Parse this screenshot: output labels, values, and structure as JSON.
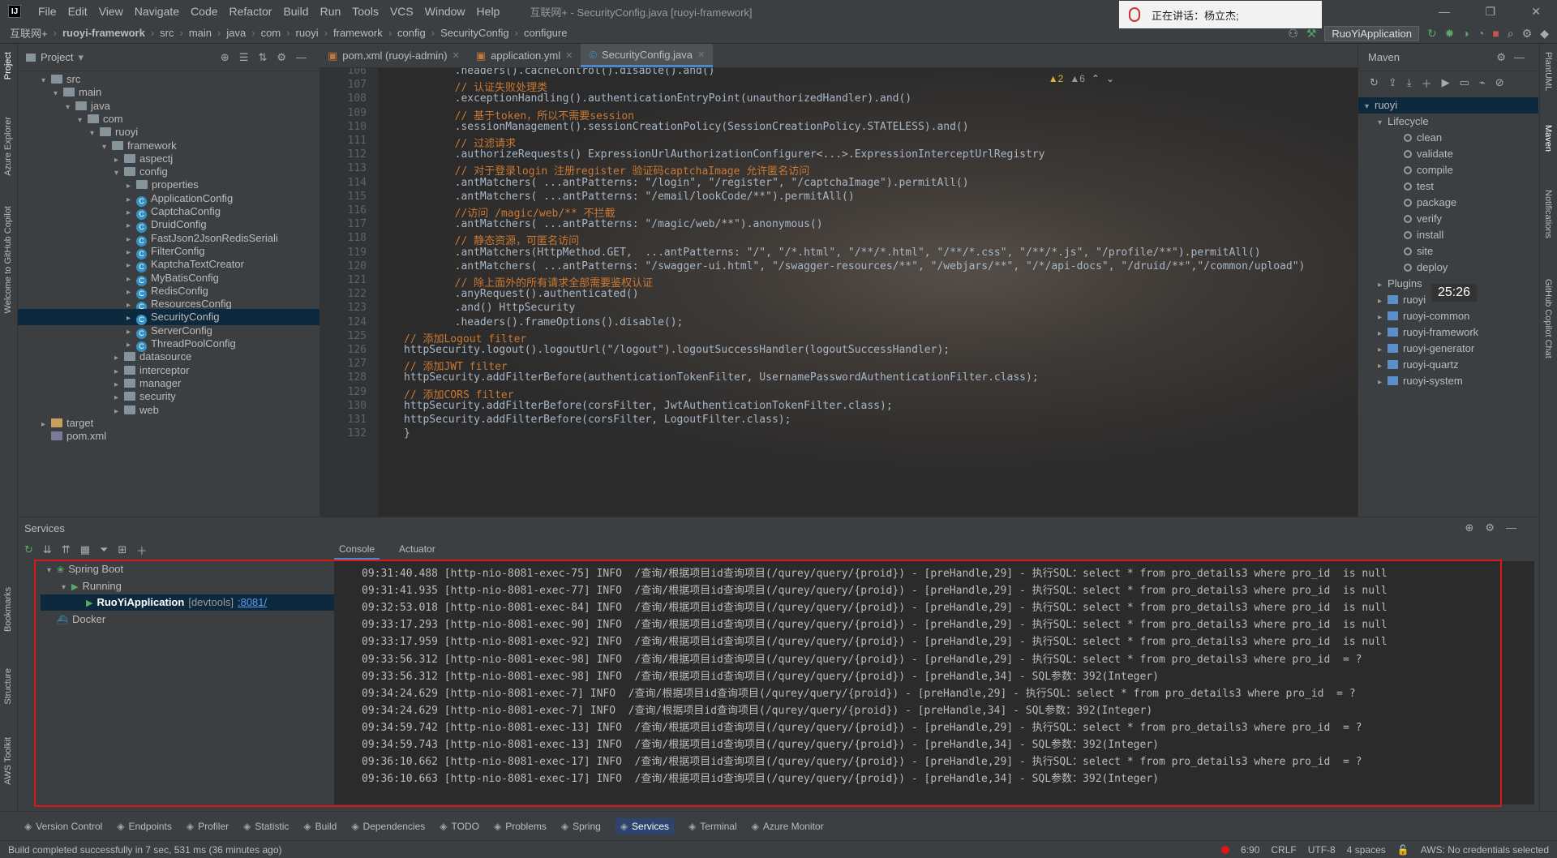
{
  "window": {
    "logo": "IJ",
    "menu": [
      "File",
      "Edit",
      "View",
      "Navigate",
      "Code",
      "Refactor",
      "Build",
      "Run",
      "Tools",
      "VCS",
      "Window",
      "Help"
    ],
    "title": "互联网+ - SecurityConfig.java [ruoyi-framework]",
    "speaking_label": "正在讲话：杨立杰;"
  },
  "breadcrumb": [
    "互联网+",
    "ruoyi-framework",
    "src",
    "main",
    "java",
    "com",
    "ruoyi",
    "framework",
    "config",
    "SecurityConfig",
    "configure"
  ],
  "run_config": "RuoYiApplication",
  "project": {
    "header": "Project",
    "tree": [
      {
        "label": "src",
        "depth": 1,
        "kind": "folder",
        "arrow": "▾"
      },
      {
        "label": "main",
        "depth": 2,
        "kind": "folder",
        "arrow": "▾"
      },
      {
        "label": "java",
        "depth": 3,
        "kind": "folder",
        "arrow": "▾"
      },
      {
        "label": "com",
        "depth": 4,
        "kind": "folder",
        "arrow": "▾"
      },
      {
        "label": "ruoyi",
        "depth": 5,
        "kind": "folder",
        "arrow": "▾"
      },
      {
        "label": "framework",
        "depth": 6,
        "kind": "folder",
        "arrow": "▾"
      },
      {
        "label": "aspectj",
        "depth": 7,
        "kind": "folder",
        "arrow": "▸"
      },
      {
        "label": "config",
        "depth": 7,
        "kind": "folder",
        "arrow": "▾"
      },
      {
        "label": "properties",
        "depth": 8,
        "kind": "folder",
        "arrow": "▸"
      },
      {
        "label": "ApplicationConfig",
        "depth": 8,
        "kind": "class",
        "arrow": "▸"
      },
      {
        "label": "CaptchaConfig",
        "depth": 8,
        "kind": "class",
        "arrow": "▸"
      },
      {
        "label": "DruidConfig",
        "depth": 8,
        "kind": "class",
        "arrow": "▸"
      },
      {
        "label": "FastJson2JsonRedisSeriali",
        "depth": 8,
        "kind": "class",
        "arrow": "▸"
      },
      {
        "label": "FilterConfig",
        "depth": 8,
        "kind": "class",
        "arrow": "▸"
      },
      {
        "label": "KaptchaTextCreator",
        "depth": 8,
        "kind": "class",
        "arrow": "▸"
      },
      {
        "label": "MyBatisConfig",
        "depth": 8,
        "kind": "class",
        "arrow": "▸"
      },
      {
        "label": "RedisConfig",
        "depth": 8,
        "kind": "class",
        "arrow": "▸"
      },
      {
        "label": "ResourcesConfig",
        "depth": 8,
        "kind": "class",
        "arrow": "▸"
      },
      {
        "label": "SecurityConfig",
        "depth": 8,
        "kind": "class",
        "arrow": "▸",
        "selected": true
      },
      {
        "label": "ServerConfig",
        "depth": 8,
        "kind": "class",
        "arrow": "▸"
      },
      {
        "label": "ThreadPoolConfig",
        "depth": 8,
        "kind": "class",
        "arrow": "▸"
      },
      {
        "label": "datasource",
        "depth": 7,
        "kind": "folder",
        "arrow": "▸"
      },
      {
        "label": "interceptor",
        "depth": 7,
        "kind": "folder",
        "arrow": "▸"
      },
      {
        "label": "manager",
        "depth": 7,
        "kind": "folder",
        "arrow": "▸"
      },
      {
        "label": "security",
        "depth": 7,
        "kind": "folder",
        "arrow": "▸"
      },
      {
        "label": "web",
        "depth": 7,
        "kind": "folder",
        "arrow": "▸"
      },
      {
        "label": "target",
        "depth": 1,
        "kind": "folder-orange",
        "arrow": "▸"
      },
      {
        "label": "pom.xml",
        "depth": 1,
        "kind": "file",
        "arrow": ""
      }
    ]
  },
  "editor": {
    "tabs": [
      {
        "label": "pom.xml (ruoyi-admin)",
        "active": false
      },
      {
        "label": "application.yml",
        "active": false
      },
      {
        "label": "SecurityConfig.java",
        "active": true
      }
    ],
    "inspections": {
      "warnings": "▲2",
      "weak": "▲6"
    },
    "lines": [
      {
        "n": "106",
        "t": "        .headers().cacheControl().disable().and()",
        "c": "code"
      },
      {
        "n": "107",
        "t": "        // 认证失败处理类",
        "c": "cmt"
      },
      {
        "n": "108",
        "t": "        .exceptionHandling().authenticationEntryPoint(unauthorizedHandler).and()",
        "c": "code"
      },
      {
        "n": "109",
        "t": "        // 基于token，所以不需要session",
        "c": "cmt"
      },
      {
        "n": "110",
        "t": "        .sessionManagement().sessionCreationPolicy(SessionCreationPolicy.STATELESS).and()",
        "c": "code"
      },
      {
        "n": "111",
        "t": "        // 过滤请求",
        "c": "cmt"
      },
      {
        "n": "112",
        "t": "        .authorizeRequests() ExpressionUrlAuthorizationConfigurer<...>.ExpressionInterceptUrlRegistry",
        "c": "code"
      },
      {
        "n": "113",
        "t": "        // 对于登录login 注册register 验证码captchaImage 允许匿名访问",
        "c": "cmt"
      },
      {
        "n": "114",
        "t": "        .antMatchers( ...antPatterns: \"/login\", \"/register\", \"/captchaImage\").permitAll()",
        "c": "code"
      },
      {
        "n": "115",
        "t": "        .antMatchers( ...antPatterns: \"/email/lookCode/**\").permitAll()",
        "c": "code"
      },
      {
        "n": "116",
        "t": "        //访问 /magic/web/** 不拦截",
        "c": "cmt"
      },
      {
        "n": "117",
        "t": "        .antMatchers( ...antPatterns: \"/magic/web/**\").anonymous()",
        "c": "code"
      },
      {
        "n": "118",
        "t": "        // 静态资源，可匿名访问",
        "c": "cmt"
      },
      {
        "n": "119",
        "t": "        .antMatchers(HttpMethod.GET,  ...antPatterns: \"/\", \"/*.html\", \"/**/*.html\", \"/**/*.css\", \"/**/*.js\", \"/profile/**\").permitAll()",
        "c": "code"
      },
      {
        "n": "120",
        "t": "        .antMatchers( ...antPatterns: \"/swagger-ui.html\", \"/swagger-resources/**\", \"/webjars/**\", \"/*/api-docs\", \"/druid/**\",\"/common/upload\")",
        "c": "code"
      },
      {
        "n": "121",
        "t": "        // 除上面外的所有请求全部需要鉴权认证",
        "c": "cmt"
      },
      {
        "n": "122",
        "t": "        .anyRequest().authenticated()",
        "c": "code"
      },
      {
        "n": "123",
        "t": "        .and() HttpSecurity",
        "c": "code"
      },
      {
        "n": "124",
        "t": "        .headers().frameOptions().disable();",
        "c": "code"
      },
      {
        "n": "125",
        "t": "// 添加Logout filter",
        "c": "cmt"
      },
      {
        "n": "126",
        "t": "httpSecurity.logout().logoutUrl(\"/logout\").logoutSuccessHandler(logoutSuccessHandler);",
        "c": "code"
      },
      {
        "n": "127",
        "t": "// 添加JWT filter",
        "c": "cmt"
      },
      {
        "n": "128",
        "t": "httpSecurity.addFilterBefore(authenticationTokenFilter, UsernamePasswordAuthenticationFilter.class);",
        "c": "code"
      },
      {
        "n": "129",
        "t": "// 添加CORS filter",
        "c": "cmt"
      },
      {
        "n": "130",
        "t": "httpSecurity.addFilterBefore(corsFilter, JwtAuthenticationTokenFilter.class);",
        "c": "code"
      },
      {
        "n": "131",
        "t": "httpSecurity.addFilterBefore(corsFilter, LogoutFilter.class);",
        "c": "code"
      },
      {
        "n": "132",
        "t": "}",
        "c": "code"
      }
    ]
  },
  "maven": {
    "header": "Maven",
    "root": "ruoyi",
    "lifecycle_label": "Lifecycle",
    "goals": [
      "clean",
      "validate",
      "compile",
      "test",
      "package",
      "verify",
      "install",
      "site",
      "deploy"
    ],
    "plugins_label": "Plugins",
    "modules": [
      "ruoyi",
      "ruoyi-common",
      "ruoyi-framework",
      "ruoyi-generator",
      "ruoyi-quartz",
      "ruoyi-system"
    ],
    "timer": "25:26"
  },
  "left_stripe": [
    "Project",
    "Azure Explorer",
    "Welcome to GitHub Copilot",
    "Bookmarks",
    "Structure",
    "AWS Toolkit"
  ],
  "right_stripe": [
    "PlantUML",
    "Maven",
    "Notifications",
    "GitHub Copilot Chat"
  ],
  "services": {
    "header": "Services",
    "tree": [
      {
        "label": "Spring Boot",
        "depth": 0
      },
      {
        "label": "Running",
        "depth": 1
      },
      {
        "label": "RuoYiApplication",
        "suffix": "[devtools]",
        "port": ":8081/",
        "depth": 2,
        "selected": true
      },
      {
        "label": "Docker",
        "depth": 0
      }
    ],
    "console_tabs": [
      "Console",
      "Actuator"
    ],
    "logs": [
      "09:31:40.488 [http-nio-8081-exec-75] INFO  /查询/根据项目id查询项目(/qurey/query/{proid}) - [preHandle,29] - 执行SQL：select * from pro_details3 where pro_id  is null",
      "09:31:41.935 [http-nio-8081-exec-77] INFO  /查询/根据项目id查询项目(/qurey/query/{proid}) - [preHandle,29] - 执行SQL：select * from pro_details3 where pro_id  is null",
      "09:32:53.018 [http-nio-8081-exec-84] INFO  /查询/根据项目id查询项目(/qurey/query/{proid}) - [preHandle,29] - 执行SQL：select * from pro_details3 where pro_id  is null",
      "09:33:17.293 [http-nio-8081-exec-90] INFO  /查询/根据项目id查询项目(/qurey/query/{proid}) - [preHandle,29] - 执行SQL：select * from pro_details3 where pro_id  is null",
      "09:33:17.959 [http-nio-8081-exec-92] INFO  /查询/根据项目id查询项目(/qurey/query/{proid}) - [preHandle,29] - 执行SQL：select * from pro_details3 where pro_id  is null",
      "09:33:56.312 [http-nio-8081-exec-98] INFO  /查询/根据项目id查询项目(/qurey/query/{proid}) - [preHandle,29] - 执行SQL：select * from pro_details3 where pro_id  = ?",
      "09:33:56.312 [http-nio-8081-exec-98] INFO  /查询/根据项目id查询项目(/qurey/query/{proid}) - [preHandle,34] - SQL参数：392(Integer)",
      "09:34:24.629 [http-nio-8081-exec-7] INFO  /查询/根据项目id查询项目(/qurey/query/{proid}) - [preHandle,29] - 执行SQL：select * from pro_details3 where pro_id  = ?",
      "09:34:24.629 [http-nio-8081-exec-7] INFO  /查询/根据项目id查询项目(/qurey/query/{proid}) - [preHandle,34] - SQL参数：392(Integer)",
      "09:34:59.742 [http-nio-8081-exec-13] INFO  /查询/根据项目id查询项目(/qurey/query/{proid}) - [preHandle,29] - 执行SQL：select * from pro_details3 where pro_id  = ?",
      "09:34:59.743 [http-nio-8081-exec-13] INFO  /查询/根据项目id查询项目(/qurey/query/{proid}) - [preHandle,34] - SQL参数：392(Integer)",
      "09:36:10.662 [http-nio-8081-exec-17] INFO  /查询/根据项目id查询项目(/qurey/query/{proid}) - [preHandle,29] - 执行SQL：select * from pro_details3 where pro_id  = ?",
      "09:36:10.663 [http-nio-8081-exec-17] INFO  /查询/根据项目id查询项目(/qurey/query/{proid}) - [preHandle,34] - SQL参数：392(Integer)"
    ]
  },
  "bottom_tools": [
    {
      "label": "Version Control",
      "active": false
    },
    {
      "label": "Endpoints",
      "active": false
    },
    {
      "label": "Profiler",
      "active": false
    },
    {
      "label": "Statistic",
      "active": false
    },
    {
      "label": "Build",
      "active": false
    },
    {
      "label": "Dependencies",
      "active": false
    },
    {
      "label": "TODO",
      "active": false
    },
    {
      "label": "Problems",
      "active": false
    },
    {
      "label": "Spring",
      "active": false
    },
    {
      "label": "Services",
      "active": true
    },
    {
      "label": "Terminal",
      "active": false
    },
    {
      "label": "Azure Monitor",
      "active": false
    }
  ],
  "status": {
    "message": "Build completed successfully in 7 sec, 531 ms (36 minutes ago)",
    "position": "6:90",
    "line_sep": "CRLF",
    "encoding": "UTF-8",
    "indent": "4 spaces",
    "aws": "AWS: No credentials selected"
  },
  "colors": {
    "accent": "#4a88c7",
    "highlight_box": "#e01515",
    "selection": "#0d293e",
    "running": "#59a869"
  }
}
